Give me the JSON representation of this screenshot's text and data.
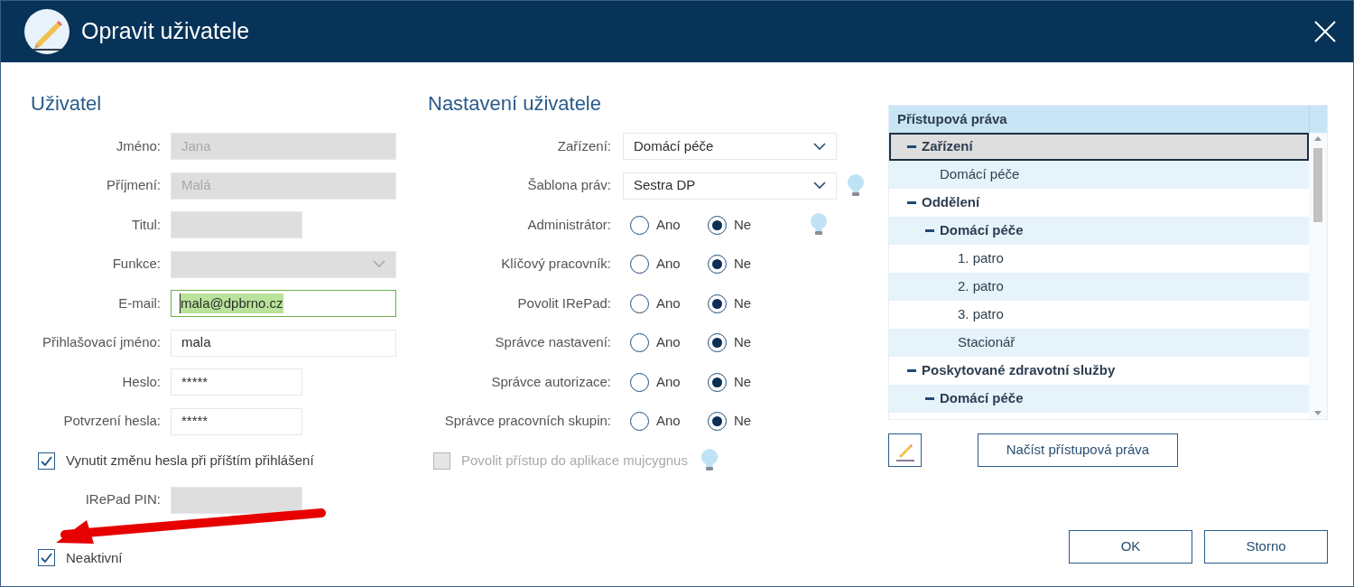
{
  "window": {
    "title": "Opravit uživatele"
  },
  "user": {
    "heading": "Uživatel",
    "fields": [
      {
        "kind": "text",
        "label": "Jméno:",
        "value": "Jana",
        "disabled": true,
        "focused": false
      },
      {
        "kind": "text",
        "label": "Příjmení:",
        "value": "Malá",
        "disabled": true,
        "focused": false
      },
      {
        "kind": "short_text",
        "label": "Titul:",
        "disabled": true,
        "focused": false
      },
      {
        "kind": "select",
        "label": "Funkce:",
        "disabled": true,
        "focused": false
      },
      {
        "kind": "text",
        "label": "E-mail:",
        "value": "mala@dpbrno.cz",
        "disabled": false,
        "focused": true
      },
      {
        "kind": "text",
        "label": "Přihlašovací jméno:",
        "value": "mala",
        "disabled": false,
        "focused": false
      },
      {
        "kind": "short_text",
        "label": "Heslo:",
        "value": "*****",
        "disabled": false,
        "focused": false
      },
      {
        "kind": "short_text",
        "label": "Potvrzení hesla:",
        "value": "*****",
        "disabled": false,
        "focused": false
      },
      {
        "kind": "checkbox",
        "label": "Vynutit změnu hesla při příštím přihlášení",
        "checked": true,
        "disabled": false
      },
      {
        "kind": "short_text",
        "label": "IRePad PIN:",
        "disabled": true,
        "focused": false
      }
    ],
    "inactive": {
      "label": "Neaktivní",
      "checked": true
    }
  },
  "settings": {
    "heading": "Nastavení uživatele",
    "rows": [
      {
        "kind": "select",
        "label": "Zařízení:",
        "value": "Domácí péče",
        "hint": false
      },
      {
        "kind": "select",
        "label": "Šablona práv:",
        "value": "Sestra DP",
        "hint": true
      },
      {
        "kind": "radio",
        "label": "Administrátor:",
        "options": [
          {
            "label": "Ano",
            "selected": false
          },
          {
            "label": "Ne",
            "selected": true
          }
        ],
        "hint": true
      },
      {
        "kind": "radio",
        "label": "Klíčový pracovník:",
        "options": [
          {
            "label": "Ano",
            "selected": false
          },
          {
            "label": "Ne",
            "selected": true
          }
        ],
        "hint": false
      },
      {
        "kind": "radio",
        "label": "Povolit IRePad:",
        "options": [
          {
            "label": "Ano",
            "selected": false
          },
          {
            "label": "Ne",
            "selected": true
          }
        ],
        "hint": false
      },
      {
        "kind": "radio",
        "label": "Správce nastavení:",
        "options": [
          {
            "label": "Ano",
            "selected": false
          },
          {
            "label": "Ne",
            "selected": true
          }
        ],
        "hint": false
      },
      {
        "kind": "radio",
        "label": "Správce autorizace:",
        "options": [
          {
            "label": "Ano",
            "selected": false
          },
          {
            "label": "Ne",
            "selected": true
          }
        ],
        "hint": false
      },
      {
        "kind": "radio",
        "label": "Správce pracovních skupin:",
        "options": [
          {
            "label": "Ano",
            "selected": false
          },
          {
            "label": "Ne",
            "selected": true
          }
        ],
        "hint": false
      },
      {
        "kind": "checkbox",
        "label": "Povolit přístup do aplikace mujcygnus",
        "checked": false,
        "disabled": true,
        "hint": true
      }
    ]
  },
  "rights": {
    "header": "Přístupová práva",
    "tree": [
      {
        "label": "Zařízení",
        "expanded": true,
        "selected": true,
        "children": [
          {
            "label": "Domácí péče",
            "selected": false
          }
        ]
      },
      {
        "label": "Oddělení",
        "expanded": true,
        "selected": false,
        "children": [
          {
            "label": "Domácí péče",
            "expanded": true,
            "selected": false,
            "children": [
              {
                "label": "1. patro",
                "selected": false
              },
              {
                "label": "2. patro",
                "selected": false
              },
              {
                "label": "3. patro",
                "selected": false
              },
              {
                "label": "Stacionář",
                "selected": false
              }
            ]
          }
        ]
      },
      {
        "label": "Poskytované zdravotní služby",
        "expanded": true,
        "selected": false,
        "children": [
          {
            "label": "Domácí péče",
            "expanded": true,
            "selected": false
          }
        ]
      }
    ],
    "load_button": "Načíst přístupová práva"
  },
  "buttons": [
    "OK",
    "Storno"
  ]
}
